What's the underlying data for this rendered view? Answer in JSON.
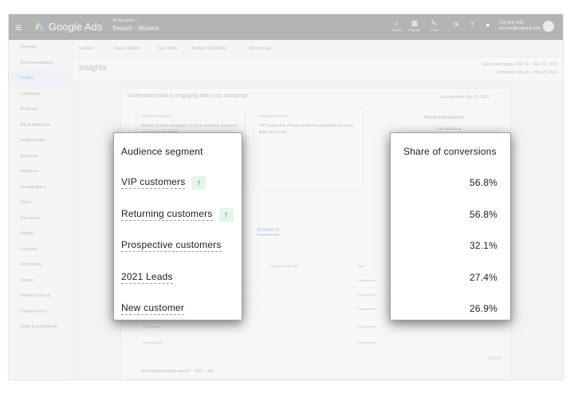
{
  "app": {
    "brand": "Google Ads",
    "account_path": "All accounts ›",
    "campaign": "Search - Movers",
    "phone": "123-456-7890",
    "email": "account@example.com",
    "tools": [
      {
        "icon": "search-icon",
        "glyph": "⌕",
        "label": "Search"
      },
      {
        "icon": "reports-icon",
        "glyph": "▦",
        "label": "Reports"
      },
      {
        "icon": "tools-icon",
        "glyph": "✎",
        "label": "Tools"
      }
    ]
  },
  "sidebar": {
    "items": [
      "Overview",
      "Recommendations",
      "Insights",
      "Campaigns",
      "Ad groups",
      "Ads & extensions",
      "Landing pages",
      "Keywords",
      "Audiences",
      "Demographics",
      "Topics",
      "Placements",
      "Settings",
      "Locations",
      "Ad schedule",
      "Devices",
      "Advanced bid adj.",
      "Change history",
      "Drafts & experiments"
    ],
    "active_index": 2
  },
  "filterbar": {
    "status": "Enabled",
    "type": "Status: Eligible",
    "bid": "Type: Video",
    "budget": "Budget: $60.00/day",
    "more": "More details"
  },
  "page": {
    "title": "Insights",
    "date_range": "Select date range: May 15 – May 21, 2022",
    "compared": "Compared: May 8 – May 14, 2022"
  },
  "card": {
    "heading": "Understand who is engaging with your campaign",
    "updated": "Last updated: May 24, 2022",
    "insight_label": "AUDIENCE INSIGHT",
    "insight_1": "Movers Search campaign +2 more audience segments are performing better",
    "insight_2": "VIP customers +4 more audience segments are more likely to convert",
    "recommendations": "Recommendations",
    "rec_item": "Use audience",
    "tab": "SEGMENTS",
    "col_conv": "Conversion rate rate",
    "col_type": "Type",
    "type_value": "Customer list",
    "bg_rows": [
      "2021 Leads",
      "New customer"
    ],
    "pager": "1-5 of 5",
    "more_question": "Were these insights useful?",
    "yes": "YES",
    "no": "NO"
  },
  "segments_popup": {
    "header": "Audience segment",
    "rows": [
      {
        "name": "VIP customers",
        "trend_up": true
      },
      {
        "name": "Returning customers",
        "trend_up": true
      },
      {
        "name": "Prospective customers",
        "trend_up": false
      },
      {
        "name": "2021 Leads",
        "trend_up": false
      },
      {
        "name": "New customer",
        "trend_up": false
      }
    ],
    "trend_glyph": "↑"
  },
  "share_popup": {
    "header": "Share of conversions",
    "values": [
      "56.8%",
      "56.8%",
      "32.1%",
      "27.4%",
      "26.9%"
    ]
  },
  "colors": {
    "badge_bg": "#e6f4ea",
    "badge_fg": "#188038",
    "accent": "#1a73e8"
  }
}
